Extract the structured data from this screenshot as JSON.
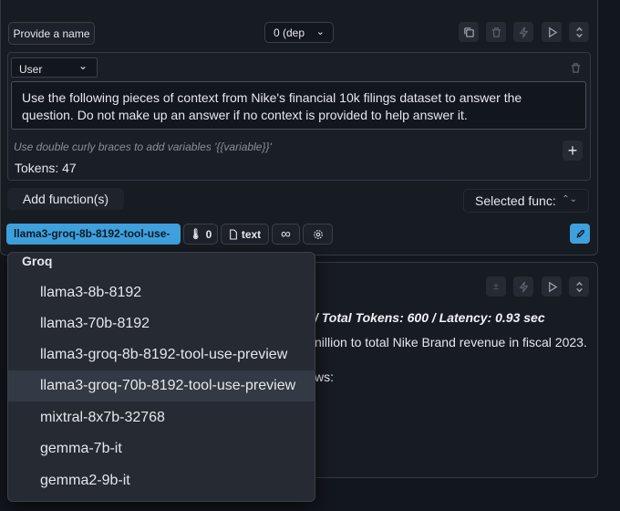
{
  "header": {
    "name_button": "Provide a name",
    "model_select": "0 (dep"
  },
  "message": {
    "role": "User",
    "content": "Use the following pieces of context from Nike's financial 10k filings dataset to answer the question. Do not make up an answer if no context is provided to help answer it.",
    "hint": "Use double curly braces to add variables '{{variable}}'",
    "tokens": "Tokens: 47"
  },
  "functions": {
    "add_label": "Add function(s)",
    "selected_label": "Selected func:"
  },
  "toolbar": {
    "model": "llama3-groq-8b-8192-tool-use-",
    "temperature": "0",
    "format": "text",
    "infinity": "∞"
  },
  "response": {
    "stats": "/ Total Tokens: 600 / Latency: 0.93 sec",
    "line1": "nillion to total Nike Brand revenue in fiscal 2023.",
    "line2": "ws:"
  },
  "dropdown": {
    "group": "Groq",
    "items": [
      "llama3-8b-8192",
      "llama3-70b-8192",
      "llama3-groq-8b-8192-tool-use-preview",
      "llama3-groq-70b-8192-tool-use-preview",
      "mixtral-8x7b-32768",
      "gemma-7b-it",
      "gemma2-9b-it"
    ],
    "highlighted_index": 3
  },
  "colors": {
    "accent": "#3ea0dc",
    "background": "#12161d",
    "panel": "#171b22"
  }
}
